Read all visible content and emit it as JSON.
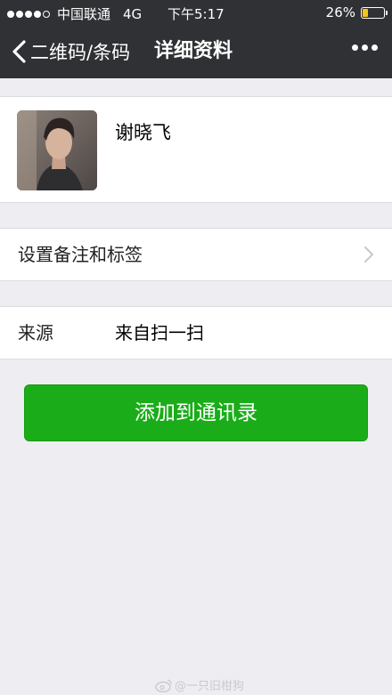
{
  "status_bar": {
    "carrier": "中国联通",
    "network": "4G",
    "time": "下午5:17",
    "battery": "26%",
    "battery_level": 0.26,
    "signal_bars": 4,
    "signal_total": 5
  },
  "nav": {
    "back_label": "二维码/条码",
    "title": "详细资料",
    "back_icon": "chevron-left-icon",
    "more_icon": "more-dots-icon"
  },
  "profile": {
    "name": "谢晓飞"
  },
  "remark_row": {
    "label": "设置备注和标签"
  },
  "source_row": {
    "label": "来源",
    "value": "来自扫一扫"
  },
  "add_button": {
    "label": "添加到通讯录"
  },
  "watermark": {
    "text": "@一只旧柑狗"
  },
  "colors": {
    "nav_bg": "#303134",
    "page_bg": "#eeedf2",
    "primary_button": "#1aad19",
    "battery": "#f5c518"
  }
}
